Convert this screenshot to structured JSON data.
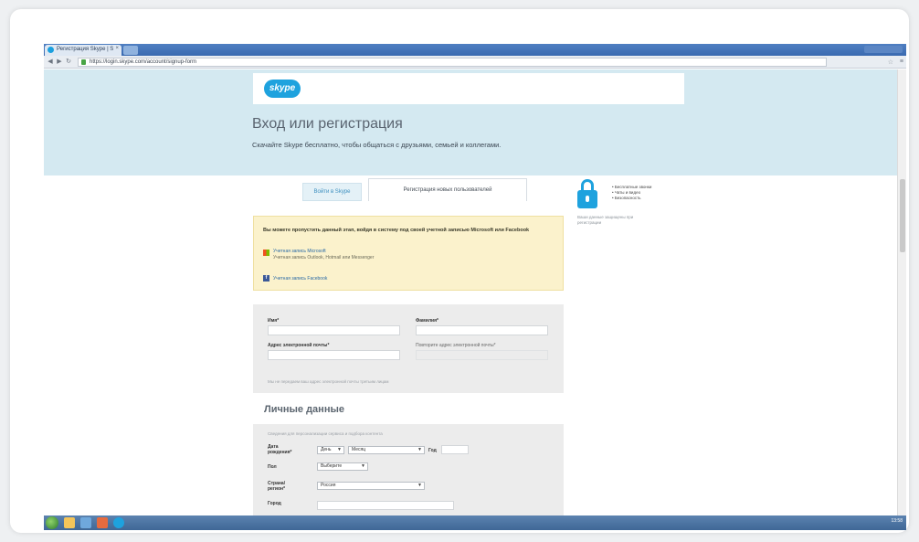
{
  "browser": {
    "tab_title": "Регистрация Skype | S",
    "tab_close": "×",
    "url": "https://login.skype.com/account/signup-form",
    "back": "◀",
    "forward": "▶",
    "reload": "↻",
    "star": "☆",
    "menu": "≡"
  },
  "hero": {
    "logo": "skype",
    "title": "Вход или регистрация",
    "subtitle": "Скачайте Skype бесплатно, чтобы общаться с друзьями, семьей и коллегами."
  },
  "tabs": {
    "signin": "Войти в Skype",
    "register": "Регистрация новых пользователей"
  },
  "notice": {
    "title": "Вы можете пропустить данный этап, войдя в систему под своей учетной записью Microsoft или Facebook",
    "ms_link": "Учетная запись Microsoft",
    "ms_sub": "Учетная запись Outlook, Hotmail или Messenger",
    "fb_link": "Учетная запись Facebook"
  },
  "form_account": {
    "first_name_label": "Имя*",
    "last_name_label": "Фамилия*",
    "email_label": "Адрес электронной почты*",
    "email_repeat_label": "Повторите адрес электронной почты*",
    "hint": "Мы не передаем ваш адрес электронной почты третьим лицам"
  },
  "personal": {
    "section_title": "Личные данные",
    "intro": "Сведения для персонализации сервиса и подбора контента",
    "birthday_label": "Дата рождения*",
    "day_value": "День",
    "month_value": "Месяц",
    "year_label": "Год",
    "gender_label": "Пол",
    "gender_value": "Выберите",
    "country_label": "Страна/регион*",
    "country_value": "Россия",
    "city_label": "Город"
  },
  "sidebar": {
    "bullets": [
      "• Бесплатные звонки",
      "• Чаты и видео",
      "• Безопасность"
    ],
    "note_line1": "Ваши данные защищены при",
    "note_line2": "регистрации"
  },
  "taskbar": {
    "clock": "13:58"
  },
  "colors": {
    "hero_bg": "#d4e9f1",
    "skype_blue": "#1ea2de",
    "notice_bg": "#fbf2cc",
    "form_bg": "#ececec"
  }
}
